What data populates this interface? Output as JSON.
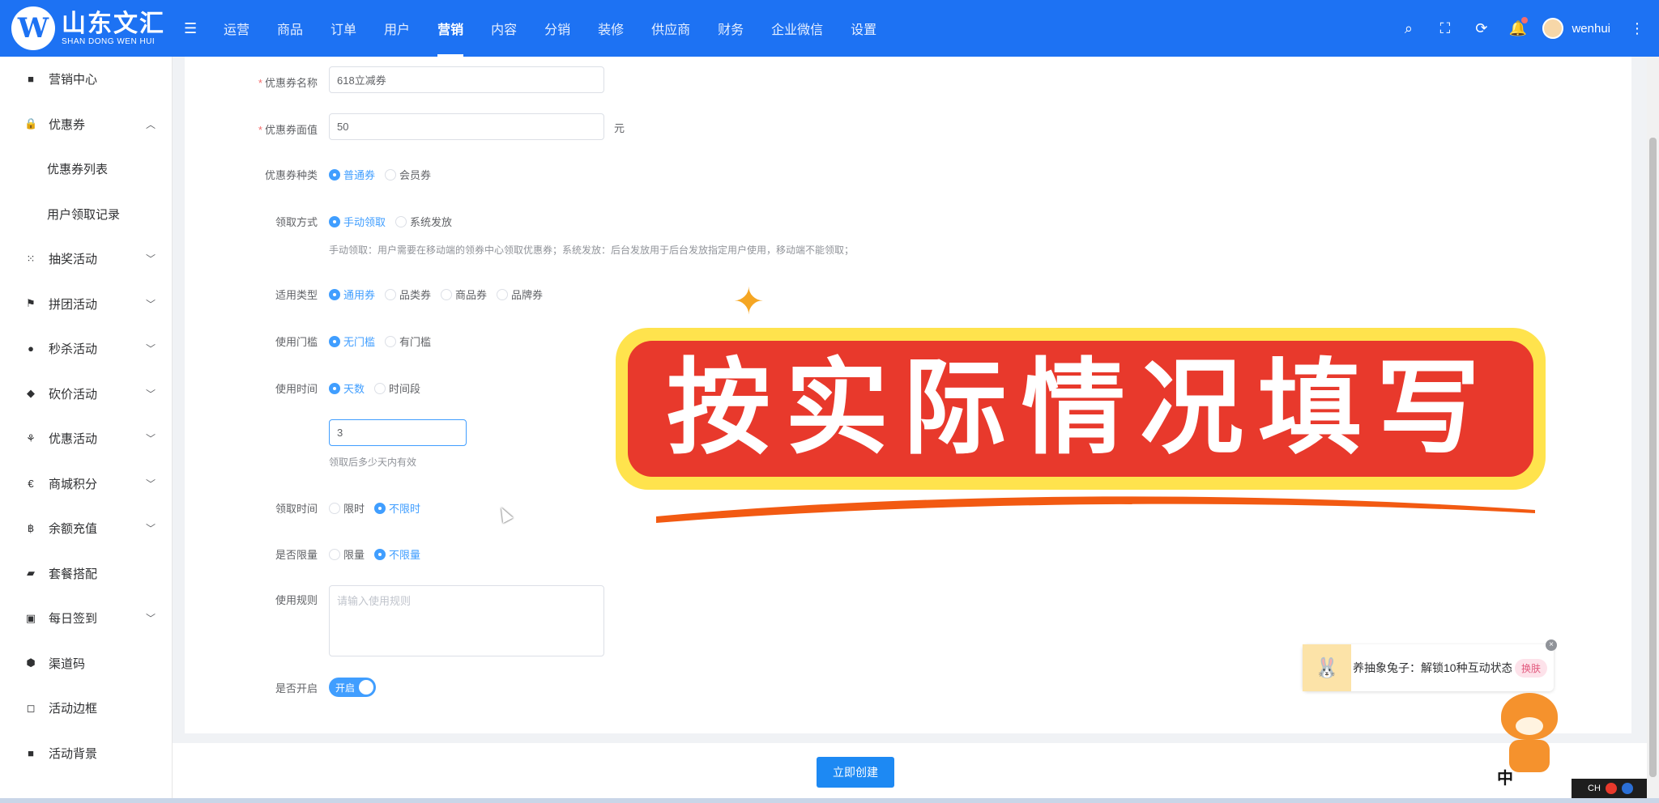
{
  "header": {
    "logo_cn": "山东文汇",
    "logo_en": "SHAN DONG WEN HUI",
    "logo_mark": "W",
    "nav": [
      "运营",
      "商品",
      "订单",
      "用户",
      "营销",
      "内容",
      "分销",
      "装修",
      "供应商",
      "财务",
      "企业微信",
      "设置"
    ],
    "active_nav": "营销",
    "username": "wenhui",
    "icons": [
      "search-icon",
      "fullscreen-icon",
      "refresh-icon",
      "bell-icon",
      "avatar",
      "more-icon"
    ]
  },
  "sidebar": {
    "items": [
      {
        "label": "营销中心",
        "icon": "gift-icon"
      },
      {
        "label": "优惠券",
        "icon": "lock-icon",
        "expanded": true
      },
      {
        "label": "优惠券列表",
        "sub": true
      },
      {
        "label": "用户领取记录",
        "sub": true
      },
      {
        "label": "抽奖活动",
        "icon": "grid-icon"
      },
      {
        "label": "拼团活动",
        "icon": "group-icon"
      },
      {
        "label": "秒杀活动",
        "icon": "flash-icon"
      },
      {
        "label": "砍价活动",
        "icon": "knife-icon"
      },
      {
        "label": "优惠活动",
        "icon": "discount-icon"
      },
      {
        "label": "商城积分",
        "icon": "euro-icon"
      },
      {
        "label": "余额充值",
        "icon": "bitcoin-icon"
      },
      {
        "label": "套餐搭配",
        "icon": "package-icon"
      },
      {
        "label": "每日签到",
        "icon": "calendar-icon"
      },
      {
        "label": "渠道码",
        "icon": "qrcode-icon"
      },
      {
        "label": "活动边框",
        "icon": "frame-icon"
      },
      {
        "label": "活动背景",
        "icon": "background-icon"
      }
    ]
  },
  "form": {
    "name_label": "优惠券名称",
    "name_value": "618立减券",
    "value_label": "优惠券面值",
    "value_value": "50",
    "value_unit": "元",
    "type_label": "优惠券种类",
    "type_options": [
      "普通券",
      "会员券"
    ],
    "receive_label": "领取方式",
    "receive_options": [
      "手动领取",
      "系统发放"
    ],
    "receive_hint": "手动领取：用户需要在移动端的领券中心领取优惠券；系统发放：后台发放用于后台发放指定用户使用，移动端不能领取；",
    "scope_label": "适用类型",
    "scope_options": [
      "通用券",
      "品类券",
      "商品券",
      "品牌券"
    ],
    "threshold_label": "使用门槛",
    "threshold_options": [
      "无门槛",
      "有门槛"
    ],
    "time_label": "使用时间",
    "time_options": [
      "天数",
      "时间段"
    ],
    "days_value": "3",
    "days_hint": "领取后多少天内有效",
    "receive_time_label": "领取时间",
    "receive_time_options": [
      "限时",
      "不限时"
    ],
    "limit_label": "是否限量",
    "limit_options": [
      "限量",
      "不限量"
    ],
    "rules_label": "使用规则",
    "rules_placeholder": "请输入使用规则",
    "enable_label": "是否开启",
    "enable_switch": "开启",
    "submit": "立即创建"
  },
  "overlay": {
    "banner_text": "按实际情况填写",
    "promo_text": "养抽象兔子：解锁10种互动状态",
    "promo_button": "换肤",
    "tiger_label": "中"
  },
  "tray": {
    "text": "CH"
  },
  "colors": {
    "primary": "#1d72f3",
    "accent": "#409eff",
    "banner_red": "#e8392c",
    "banner_yellow": "#ffe34d"
  }
}
